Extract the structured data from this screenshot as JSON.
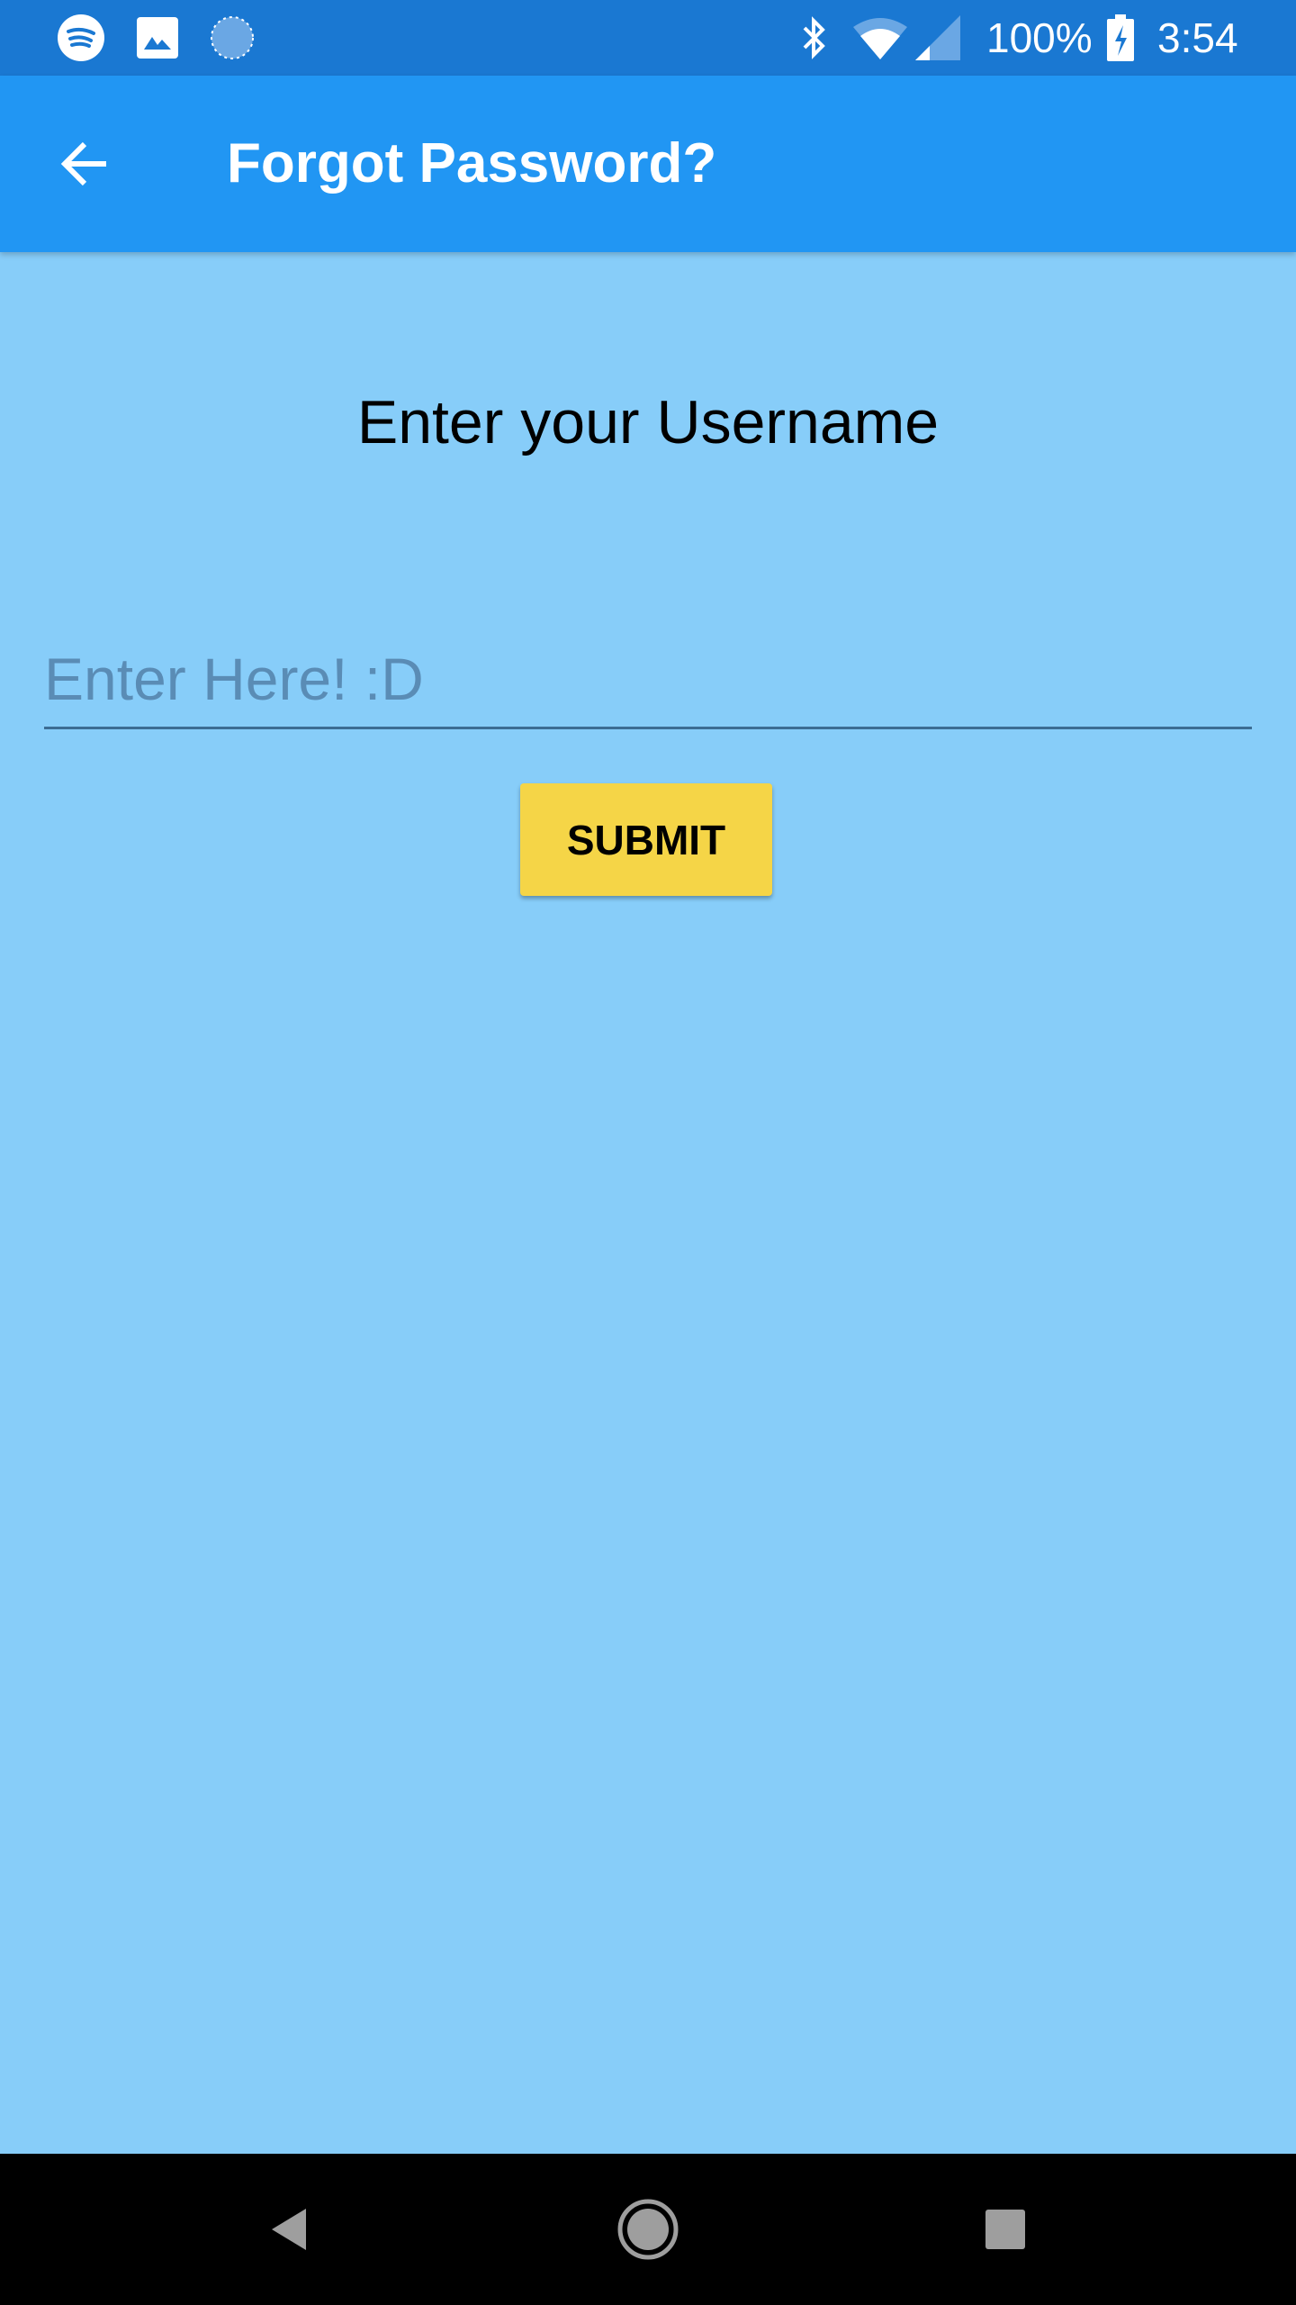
{
  "status_bar": {
    "icons_left": [
      "spotify-icon",
      "image-icon",
      "sync-icon"
    ],
    "icons_right": [
      "bluetooth-icon",
      "wifi-icon",
      "signal-icon",
      "battery-charging-icon"
    ],
    "battery": "100%",
    "time": "3:54",
    "color": "#1a78d2"
  },
  "app_bar": {
    "title": "Forgot Password?",
    "color": "#2196f3"
  },
  "main": {
    "heading": "Enter your Username",
    "username_input": {
      "value": "",
      "placeholder": "Enter Here! :D"
    },
    "submit_label": "SUBMIT",
    "submit_color": "#f5d547",
    "background": "#87cdf9"
  },
  "nav_bar": {
    "buttons": [
      "back",
      "home",
      "recents"
    ]
  }
}
